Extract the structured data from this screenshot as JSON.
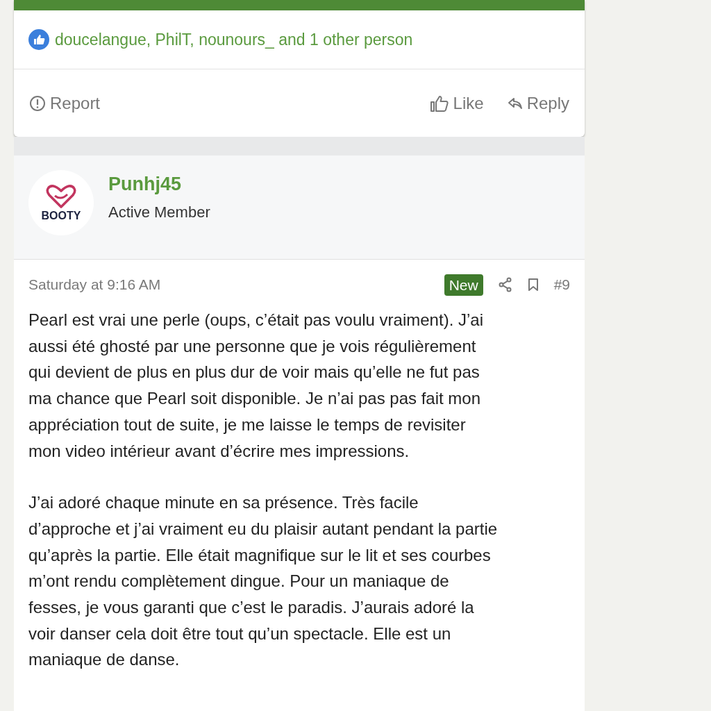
{
  "previous_post": {
    "reactions": "doucelangue, PhilT, nounours_ and 1 other person",
    "actions": [
      {
        "kind": "report",
        "label": "Report"
      },
      {
        "kind": "like",
        "label": "Like"
      },
      {
        "kind": "reply",
        "label": "Reply"
      }
    ]
  },
  "post": {
    "author": "Punhj45",
    "avatar_text": "BOOTY",
    "role": "Active Member",
    "date": "Saturday at 9:16 AM",
    "badge": "New",
    "number": "#9",
    "paragraphs": [
      [
        "Pearl est vrai une perle (oups, c’était pas voulu vraiment). J’ai",
        "aussi été ghosté par une personne que je vois régulièrement",
        "qui devient de plus en plus dur de voir mais qu’elle ne fut pas",
        "ma chance que Pearl soit disponible. Je n’ai pas pas fait mon",
        "appréciation tout de suite, je me laisse le temps de revisiter",
        "mon video intérieur avant d’écrire mes impressions."
      ],
      [
        "J’ai adoré chaque minute en sa présence. Très facile",
        "d’approche et j’ai vraiment eu du plaisir autant pendant la partie",
        "qu’après la partie. Elle était magnifique sur le lit et ses courbes",
        "m’ont rendu complètement dingue. Pour un maniaque de",
        "fesses, je vous garanti que c’est le paradis. J’aurais adoré la",
        "voir danser cela doit être tout qu’un spectacle. Elle est un",
        "maniaque de danse."
      ]
    ]
  }
}
